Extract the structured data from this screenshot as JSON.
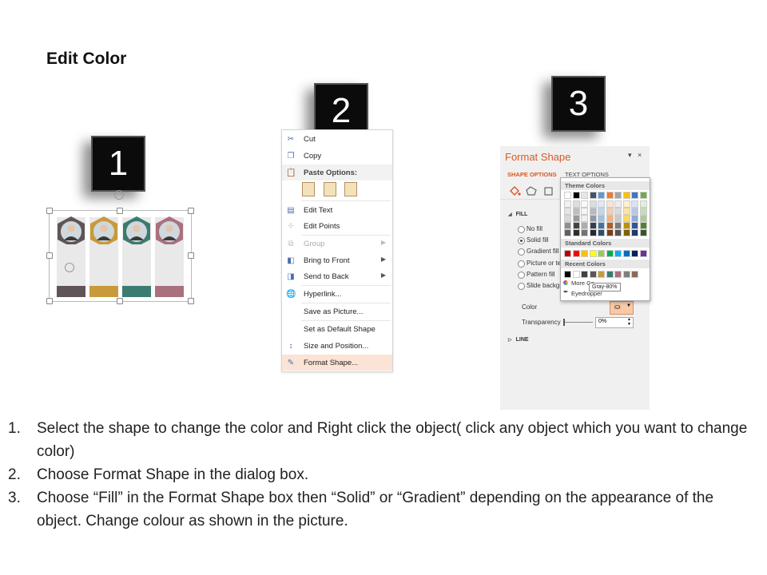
{
  "heading": "Edit Color",
  "steps_badges": [
    "1",
    "2",
    "3"
  ],
  "infographic": {
    "columns": [
      {
        "ring_color": "#5f5558",
        "bar_color": "#5f5558"
      },
      {
        "ring_color": "#c99a3b",
        "bar_color": "#c99a3b"
      },
      {
        "ring_color": "#3c7b70",
        "bar_color": "#3c7b70"
      },
      {
        "ring_color": "#a9707e",
        "bar_color": "#a9707e"
      }
    ]
  },
  "context_menu": {
    "items": [
      {
        "label": "Cut",
        "icon": "scissors-icon"
      },
      {
        "label": "Copy",
        "icon": "copy-icon"
      },
      {
        "label": "Paste Options:",
        "icon": "paste-icon"
      },
      {
        "label": "Edit Text",
        "icon": "edit-text-icon"
      },
      {
        "label": "Edit Points",
        "icon": "edit-points-icon"
      },
      {
        "label": "Group",
        "icon": "group-icon"
      },
      {
        "label": "Bring to Front",
        "icon": "bring-front-icon"
      },
      {
        "label": "Send to Back",
        "icon": "send-back-icon"
      },
      {
        "label": "Hyperlink...",
        "icon": "hyperlink-icon"
      },
      {
        "label": "Save as Picture...",
        "icon": ""
      },
      {
        "label": "Set as Default Shape",
        "icon": ""
      },
      {
        "label": "Size and Position...",
        "icon": "size-position-icon"
      },
      {
        "label": "Format Shape...",
        "icon": "format-shape-icon"
      }
    ]
  },
  "format_pane": {
    "title": "Format Shape",
    "pin": "▾",
    "close": "×",
    "tabs": [
      "SHAPE OPTIONS",
      "TEXT OPTIONS"
    ],
    "fill_section": "FILL",
    "fill_options": [
      "No fill",
      "Solid fill",
      "Gradient fill",
      "Picture or te",
      "Pattern fill",
      "Slide backgr"
    ],
    "selected_fill": "Solid fill",
    "color_label": "Color",
    "transparency_label": "Transparency",
    "transparency_value": "0%",
    "line_section": "LINE"
  },
  "color_popup": {
    "theme_header": "Theme Colors",
    "standard_header": "Standard Colors",
    "recent_header": "Recent Colors",
    "more_colors": "More Co",
    "eyedropper": "Eyedropper",
    "tooltip": "Gray-80%",
    "theme_top": [
      "#ffffff",
      "#000000",
      "#e7e6e6",
      "#44546a",
      "#5b9bd5",
      "#ed7d31",
      "#a5a5a5",
      "#ffc000",
      "#4472c4",
      "#70ad47"
    ],
    "standard": [
      "#c00000",
      "#ff0000",
      "#ffc000",
      "#ffff00",
      "#92d050",
      "#00b050",
      "#00b0f0",
      "#0070c0",
      "#002060",
      "#7030a0"
    ],
    "recent": [
      "#000000",
      "#ffffff",
      "#404040",
      "#5f5558",
      "#c99a3b",
      "#3c7b70",
      "#a9707e",
      "#7f7f7f",
      "#8a6b5a"
    ]
  },
  "instructions": [
    {
      "num": "1.",
      "text": "Select the shape to change the color and Right click the object( click any object which you want to change color)"
    },
    {
      "num": "2.",
      "text": "Choose Format Shape in the dialog box."
    },
    {
      "num": "3.",
      "text": "Choose “Fill” in the Format Shape box then “Solid” or “Gradient” depending on the appearance of the object. Change colour as shown in the picture."
    }
  ]
}
